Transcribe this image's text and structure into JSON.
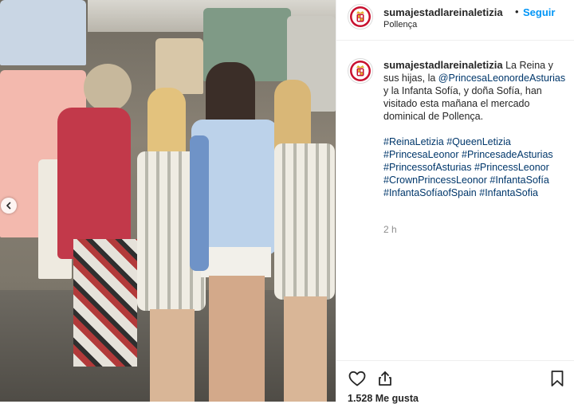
{
  "post": {
    "username": "sumajestadlareinaletizia",
    "separator": "•",
    "follow_label": "Seguir",
    "location": "Pollença",
    "caption_text": "La Reina y sus hijas, la",
    "caption_mention": "@PrincesaLeonordeAsturias",
    "caption_rest": " y la Infanta Sofía, y doña Sofía, han visitado esta mañana el mercado dominical de Pollença.",
    "hashtags": [
      "#ReinaLetizia",
      "#QueenLetizia",
      "#PrincesaLeonor",
      "#PrincesadeAsturias",
      "#PrincessofAsturias",
      "#PrincessLeonor",
      "#CrownPrincessLeonor",
      "#InfantaSofía",
      "#InfantaSofíaofSpain",
      "#InfantaSofia"
    ],
    "time": "2 h",
    "likes": "1.528 Me gusta"
  },
  "icons": {
    "avatar": "royal-crest-icon",
    "carousel_prev": "chevron-left-icon",
    "like": "heart-icon",
    "share": "share-icon",
    "save": "bookmark-icon"
  },
  "colors": {
    "follow": "#0095f6",
    "link": "#00376b",
    "text": "#262626",
    "muted": "#8e8e8e",
    "crest_red": "#c8102e",
    "crest_gold": "#e3b12f"
  }
}
